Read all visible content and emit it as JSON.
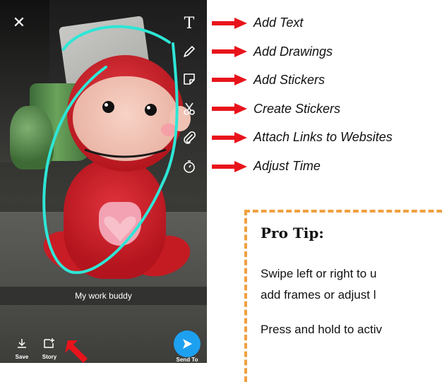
{
  "phone": {
    "close_icon": "close-icon",
    "tools": [
      "text-tool-icon",
      "pencil-icon",
      "sticker-icon",
      "scissors-icon",
      "paperclip-icon",
      "timer-icon"
    ],
    "tool_text_glyph": "T",
    "caption": "My work buddy",
    "save_label": "Save",
    "story_label": "Story",
    "send_label": "Send To",
    "accent_color": "#1ea0f1",
    "drawing_color": "#2ee6d6"
  },
  "annotations": {
    "labels": [
      "Add Text",
      "Add Drawings",
      "Add Stickers",
      "Create Stickers",
      "Attach Links to Websites",
      "Adjust Time"
    ],
    "arrow_color": "#e8131b"
  },
  "pro_tip": {
    "title": "Pro Tip:",
    "lines": [
      "Swipe left or right to u",
      "add frames or adjust l",
      "Press and hold to activ"
    ],
    "border_color": "#f0a040"
  }
}
